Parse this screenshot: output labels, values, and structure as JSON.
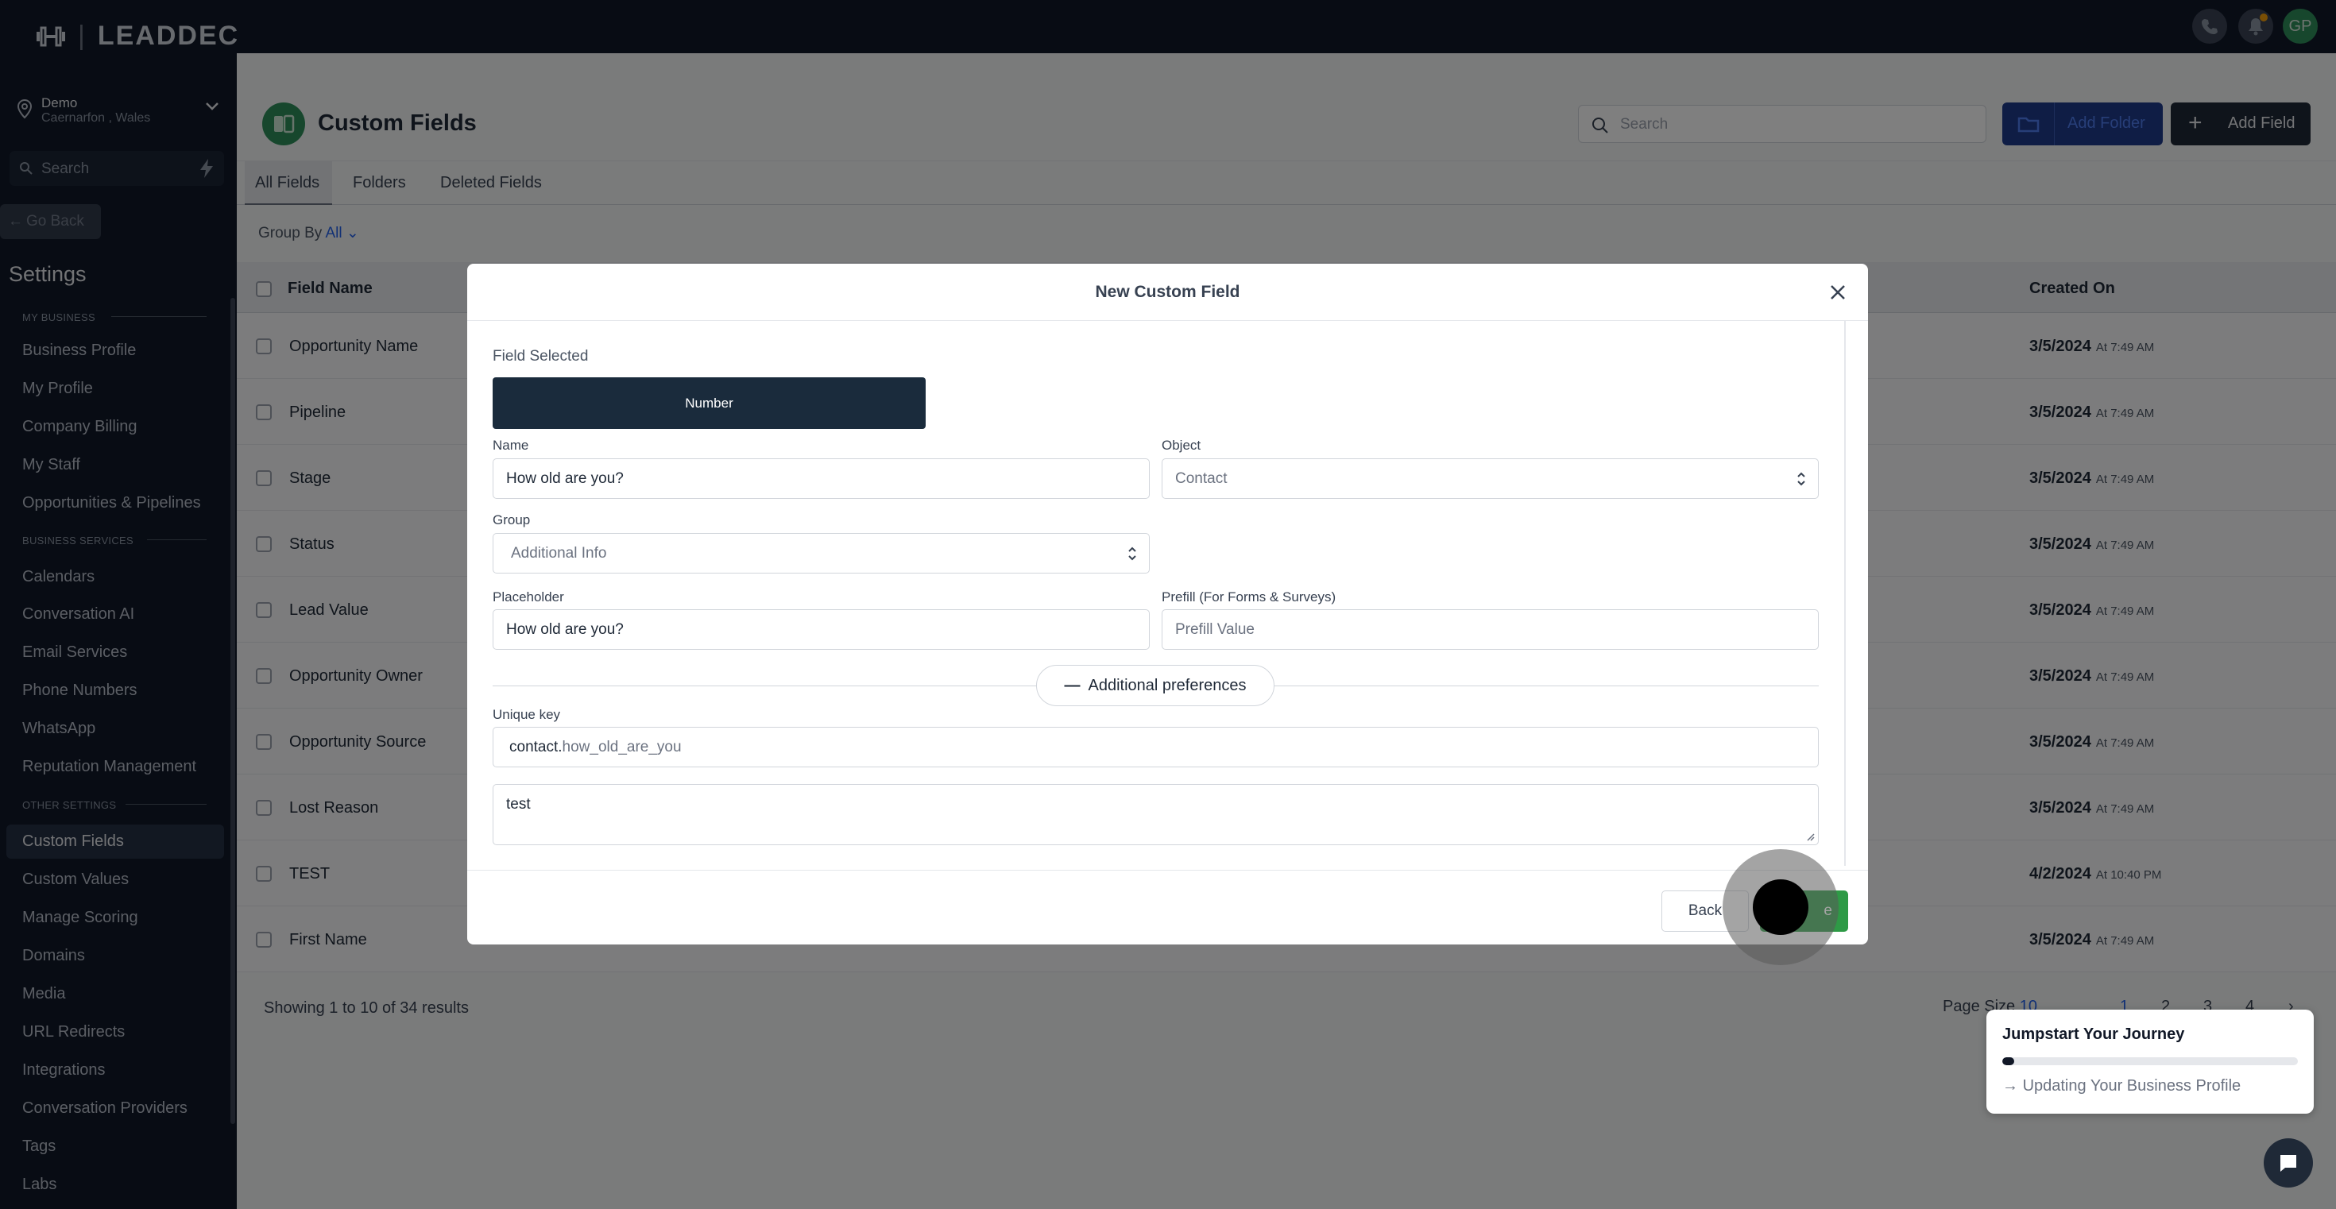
{
  "app": {
    "logo_text": "LEADDEC",
    "location": {
      "name": "Demo",
      "address": "Caernarfon , Wales"
    },
    "avatar_initials": "GP"
  },
  "sidebar": {
    "search_placeholder": "Search",
    "go_back_label": "Go Back",
    "title": "Settings",
    "sections": {
      "my_business": "MY BUSINESS",
      "business_services": "BUSINESS SERVICES",
      "other_settings": "OTHER SETTINGS"
    },
    "my_business_items": [
      "Business Profile",
      "My Profile",
      "Company Billing",
      "My Staff",
      "Opportunities & Pipelines"
    ],
    "business_services_items": [
      "Calendars",
      "Conversation AI",
      "Email Services",
      "Phone Numbers",
      "WhatsApp",
      "Reputation Management"
    ],
    "other_settings_items": [
      "Custom Fields",
      "Custom Values",
      "Manage Scoring",
      "Domains",
      "Media",
      "URL Redirects",
      "Integrations",
      "Conversation Providers",
      "Tags",
      "Labs"
    ],
    "active_item": "Custom Fields"
  },
  "page": {
    "title": "Custom Fields",
    "search_placeholder": "Search",
    "add_folder_label": "Add Folder",
    "add_field_label": "Add Field",
    "tabs": [
      "All Fields",
      "Folders",
      "Deleted Fields"
    ],
    "active_tab": "All Fields",
    "group_by_label": "Group By",
    "group_by_value": "All"
  },
  "table": {
    "columns": [
      "Field Name",
      "Created On"
    ],
    "rows": [
      {
        "name": "Opportunity Name",
        "date": "3/5/2024",
        "time": "At 7:49 AM"
      },
      {
        "name": "Pipeline",
        "date": "3/5/2024",
        "time": "At 7:49 AM"
      },
      {
        "name": "Stage",
        "date": "3/5/2024",
        "time": "At 7:49 AM"
      },
      {
        "name": "Status",
        "date": "3/5/2024",
        "time": "At 7:49 AM"
      },
      {
        "name": "Lead Value",
        "date": "3/5/2024",
        "time": "At 7:49 AM"
      },
      {
        "name": "Opportunity Owner",
        "date": "3/5/2024",
        "time": "At 7:49 AM"
      },
      {
        "name": "Opportunity Source",
        "date": "3/5/2024",
        "time": "At 7:49 AM"
      },
      {
        "name": "Lost Reason",
        "date": "3/5/2024",
        "time": "At 7:49 AM"
      },
      {
        "name": "TEST",
        "date": "4/2/2024",
        "time": "At 10:40 PM"
      },
      {
        "name": "First Name",
        "date": "3/5/2024",
        "time": "At 7:49 AM"
      }
    ],
    "showing_text": "Showing 1 to 10 of 34 results",
    "page_size_label": "Page Size",
    "page_size_value": "10",
    "pages": [
      "1",
      "2",
      "3",
      "4"
    ]
  },
  "modal": {
    "title": "New Custom Field",
    "field_selected_label": "Field Selected",
    "field_type": "Number",
    "name_label": "Name",
    "name_value": "How old are you?",
    "object_label": "Object",
    "object_value": "Contact",
    "group_label": "Group",
    "group_value": "Additional Info",
    "placeholder_label": "Placeholder",
    "placeholder_value": "How old are you?",
    "prefill_label": "Prefill (For Forms & Surveys)",
    "prefill_placeholder": "Prefill Value",
    "additional_prefs_label": "Additional preferences",
    "unique_key_label": "Unique key",
    "unique_key_prefix": "contact.",
    "unique_key_value": "how_old_are_you",
    "textarea_value": "test",
    "back_label": "Back",
    "save_label": "Save",
    "save_visible_fragment": "e"
  },
  "jumpstart": {
    "title": "Jumpstart Your Journey",
    "step": "Updating Your Business Profile",
    "progress": 0.04
  },
  "colors": {
    "brand_green": "#2f8f5b",
    "save_green": "#2e9a46",
    "dark_navy": "#101828",
    "link_blue": "#2563eb"
  }
}
